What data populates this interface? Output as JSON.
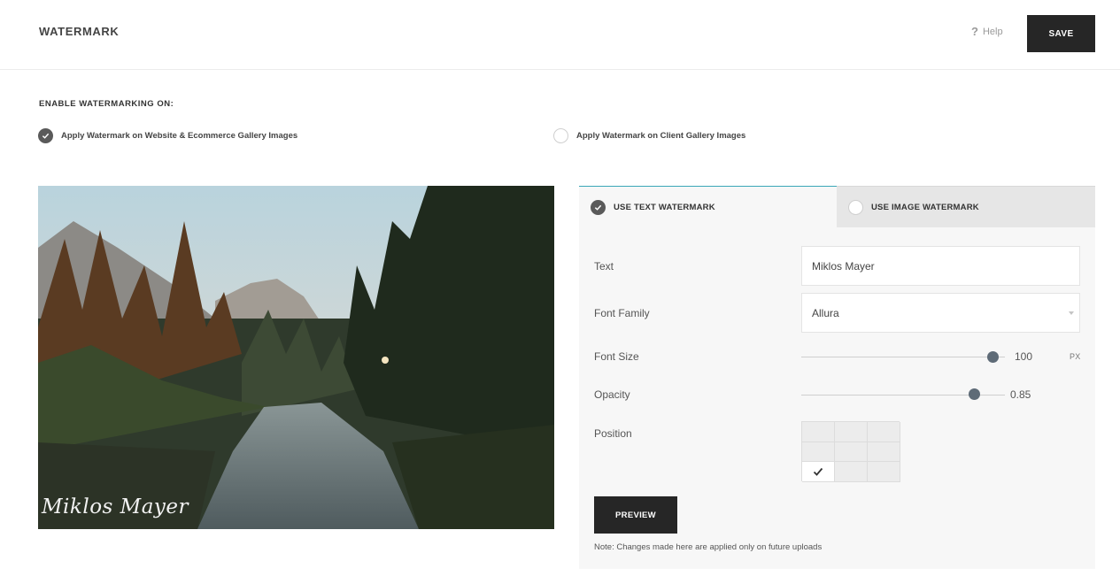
{
  "header": {
    "title": "WATERMARK",
    "help_label": "Help",
    "save_label": "SAVE"
  },
  "enable": {
    "heading": "ENABLE WATERMARKING ON:",
    "options": [
      {
        "label": "Apply Watermark on Website & Ecommerce Gallery Images",
        "checked": true
      },
      {
        "label": "Apply Watermark on Client Gallery Images",
        "checked": false
      }
    ]
  },
  "preview": {
    "watermark_text": "Miklos Mayer"
  },
  "tabs": [
    {
      "label": "USE TEXT WATERMARK",
      "active": true
    },
    {
      "label": "USE IMAGE WATERMARK",
      "active": false
    }
  ],
  "form": {
    "text_label": "Text",
    "text_value": "Miklos Mayer",
    "font_family_label": "Font Family",
    "font_family_value": "Allura",
    "font_size_label": "Font Size",
    "font_size_value": "100",
    "font_size_unit": "PX",
    "font_size_fraction": 0.94,
    "opacity_label": "Opacity",
    "opacity_value": "0.85",
    "opacity_fraction": 0.85,
    "position_label": "Position",
    "position_selected": "bottom-left",
    "preview_label": "PREVIEW",
    "note": "Note: Changes made here are applied only on future uploads"
  },
  "colors": {
    "accent": "#3aa7b8",
    "button_dark": "#262626",
    "slider_handle": "#5e6b77"
  }
}
